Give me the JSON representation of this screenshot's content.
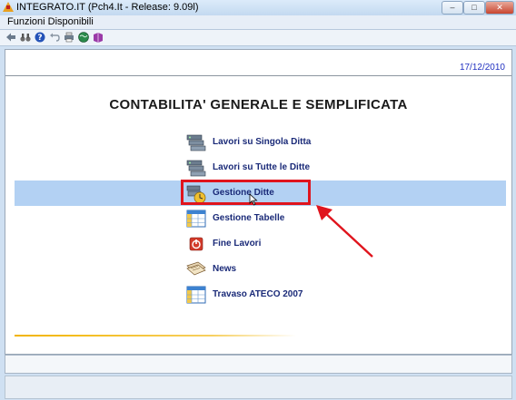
{
  "window": {
    "title": "INTEGRATO.IT  (Pch4.It - Release: 9.09l)",
    "minimize": "–",
    "maximize": "□",
    "close": "✕"
  },
  "menubar": {
    "item": "Funzioni Disponibili"
  },
  "toolbar": {
    "icons": [
      "back-arrow-icon",
      "binoculars-icon",
      "help-icon",
      "undo-icon",
      "printer-icon",
      "globe-icon",
      "book-icon"
    ]
  },
  "content": {
    "date": "17/12/2010",
    "title": "CONTABILITA' GENERALE E SEMPLIFICATA",
    "items": [
      {
        "label": "Lavori su Singola Ditta",
        "icon": "server-stack-icon"
      },
      {
        "label": "Lavori su Tutte le Ditte",
        "icon": "server-stack-icon"
      },
      {
        "label": "Gestione Ditte",
        "icon": "server-clock-icon"
      },
      {
        "label": "Gestione Tabelle",
        "icon": "table-icon"
      },
      {
        "label": "Fine Lavori",
        "icon": "power-icon"
      },
      {
        "label": "News",
        "icon": "newspaper-icon"
      },
      {
        "label": "Travaso ATECO 2007",
        "icon": "table-icon"
      }
    ],
    "selected_index": 2
  },
  "colors": {
    "highlight": "#b3d1f3",
    "annotation_red": "#e0141d",
    "label_blue": "#1a2a78",
    "date_blue": "#2030c0"
  }
}
